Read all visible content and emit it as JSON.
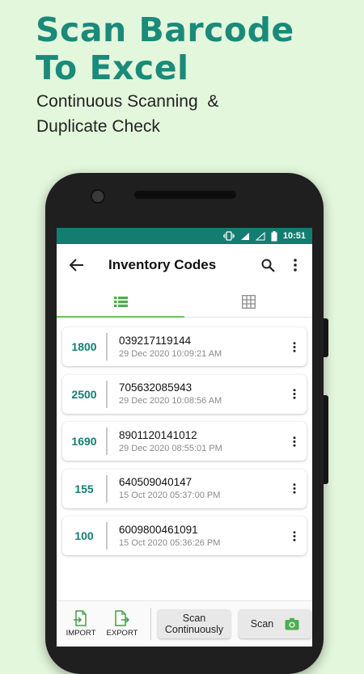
{
  "promo": {
    "title_line1": "Scan Barcode",
    "title_line2": "To Excel",
    "subtitle_line1": "Continuous Scanning  &",
    "subtitle_line2": "Duplicate Check"
  },
  "status_bar": {
    "time": "10:51"
  },
  "app_bar": {
    "title": "Inventory Codes",
    "back_icon": "arrow-back-icon",
    "search_icon": "search-icon",
    "more_icon": "more-vert-icon"
  },
  "tabs": [
    {
      "icon": "list-view-icon",
      "active": true
    },
    {
      "icon": "grid-view-icon",
      "active": false
    }
  ],
  "items": [
    {
      "qty": "1800",
      "code": "039217119144",
      "date": "29 Dec 2020 10:09:21 AM"
    },
    {
      "qty": "2500",
      "code": "705632085943",
      "date": "29 Dec 2020 10:08:56 AM"
    },
    {
      "qty": "1690",
      "code": "8901120141012",
      "date": "29 Dec 2020 08:55:01 PM"
    },
    {
      "qty": "155",
      "code": "640509040147",
      "date": "15 Oct 2020 05:37:00 PM"
    },
    {
      "qty": "100",
      "code": "6009800461091",
      "date": "15 Oct 2020 05:36:26 PM"
    }
  ],
  "bottom_bar": {
    "import_label": "IMPORT",
    "export_label": "EXPORT",
    "scan_continuously_line1": "Scan",
    "scan_continuously_line2": "Continuously",
    "scan_label": "Scan"
  },
  "colors": {
    "brand": "#147d72",
    "accent": "#6fbf5a",
    "background": "#e3f7dc"
  }
}
